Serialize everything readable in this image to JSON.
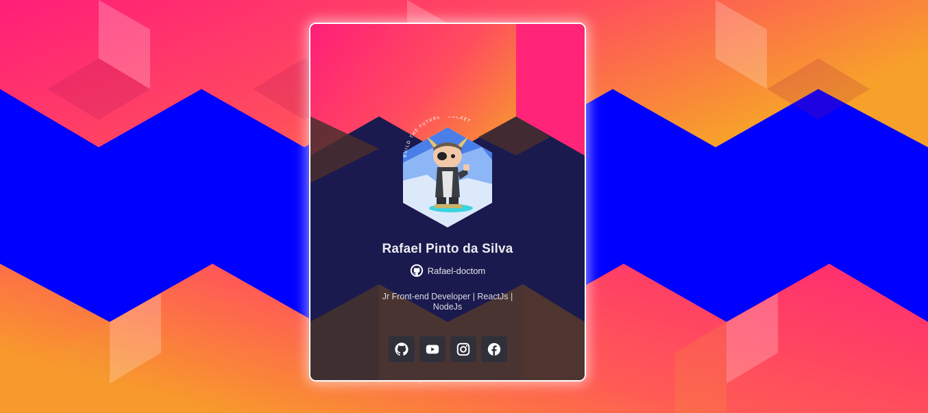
{
  "colors": {
    "background_blue": "#0000ff",
    "card_navy": "#1a1a4e",
    "warm_pink": "#ff1e78",
    "warm_orange": "#f7a12a",
    "card_border": "#ffffff",
    "button_bg": "#30303a"
  },
  "profile": {
    "name": "Rafael Pinto da Silva",
    "github_username": "Rafael-doctom",
    "bio": "Jr Front-end Developer | ReactJs | NodeJs",
    "avatar_caption": "BUILD THE FUTURE · ROCKET",
    "avatar_icon": "octocat-viking-icon"
  },
  "socials": [
    {
      "name": "github",
      "icon": "github-icon"
    },
    {
      "name": "youtube",
      "icon": "youtube-icon"
    },
    {
      "name": "instagram",
      "icon": "instagram-icon"
    },
    {
      "name": "facebook",
      "icon": "facebook-icon"
    }
  ]
}
